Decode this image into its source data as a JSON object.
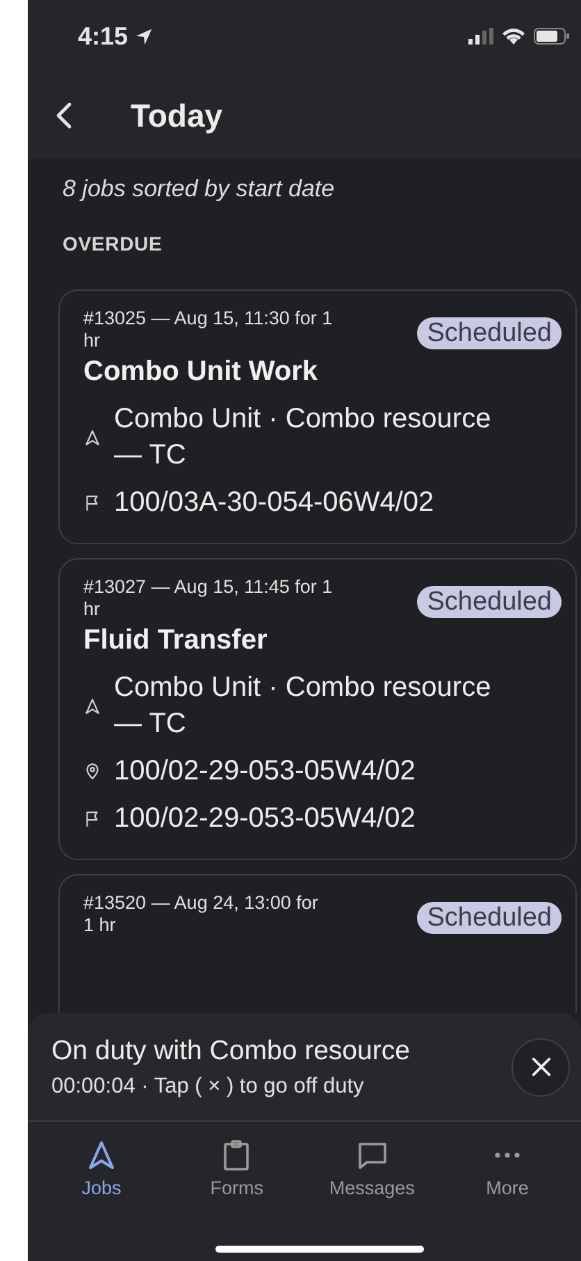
{
  "status_bar": {
    "time": "4:15"
  },
  "header": {
    "title": "Today"
  },
  "summary": "8 jobs sorted by start date",
  "section": "OVERDUE",
  "jobs": [
    {
      "meta": "#13025 — Aug 15, 11:30 for 1 hr",
      "status": "Scheduled",
      "title": "Combo Unit Work",
      "details": [
        {
          "kind": "resource",
          "text": "Combo Unit · Combo resource — TC"
        },
        {
          "kind": "surface",
          "text": "100/03A-30-054-06W4/02"
        }
      ]
    },
    {
      "meta": "#13027 — Aug 15, 11:45 for 1 hr",
      "status": "Scheduled",
      "title": "Fluid Transfer",
      "details": [
        {
          "kind": "resource",
          "text": "Combo Unit · Combo resource — TC"
        },
        {
          "kind": "location",
          "text": "100/02-29-053-05W4/02"
        },
        {
          "kind": "surface",
          "text": "100/02-29-053-05W4/02"
        }
      ]
    },
    {
      "meta": "#13520 — Aug 24, 13:00 for 1 hr",
      "status": "Scheduled"
    }
  ],
  "duty_bar": {
    "title": "On duty with Combo resource",
    "subtitle": "00:00:04 · Tap ( × ) to go off duty"
  },
  "tabs": [
    {
      "kind": "jobs",
      "label": "Jobs",
      "selected": true
    },
    {
      "kind": "forms",
      "label": "Forms",
      "selected": false
    },
    {
      "kind": "messages",
      "label": "Messages",
      "selected": false
    },
    {
      "kind": "more",
      "label": "More",
      "selected": false
    }
  ]
}
